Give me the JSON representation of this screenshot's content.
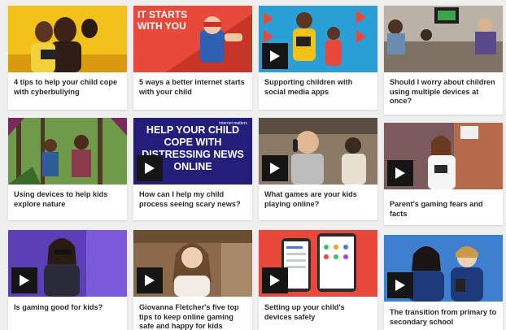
{
  "colors": {
    "accent": "#e8493a",
    "page_bg": "#efefef",
    "card_bg": "#ffffff",
    "play_bg": "#151515"
  },
  "cards": [
    {
      "title": "4 tips to help your child cope with cyberbullying",
      "video": false
    },
    {
      "title": "5 ways a better internet starts with your child",
      "video": false,
      "overlay": "IT STARTS WITH YOU"
    },
    {
      "title": "Supporting children with social media apps",
      "video": true
    },
    {
      "title": "Should I worry about children using multiple devices at once?",
      "video": false
    },
    {
      "title": "Using devices to help kids explore nature",
      "video": false
    },
    {
      "title": "How can I help my child process seeing scary news?",
      "video": true,
      "overlay": "HELP YOUR CHILD COPE WITH DISTRESSING NEWS ONLINE",
      "brand": "internet matters"
    },
    {
      "title": "What games are your kids playing online?",
      "video": true
    },
    {
      "title": "Parent's gaming fears and facts",
      "video": true
    },
    {
      "title": "Is gaming good for kids?",
      "video": true
    },
    {
      "title": "Giovanna Fletcher's five top tips to keep online gaming safe and happy for kids",
      "video": true
    },
    {
      "title": "Setting up your child's devices safely",
      "video": true
    },
    {
      "title": "The transition from primary to secondary school",
      "video": true
    }
  ],
  "icons": {
    "play": "play-icon"
  }
}
